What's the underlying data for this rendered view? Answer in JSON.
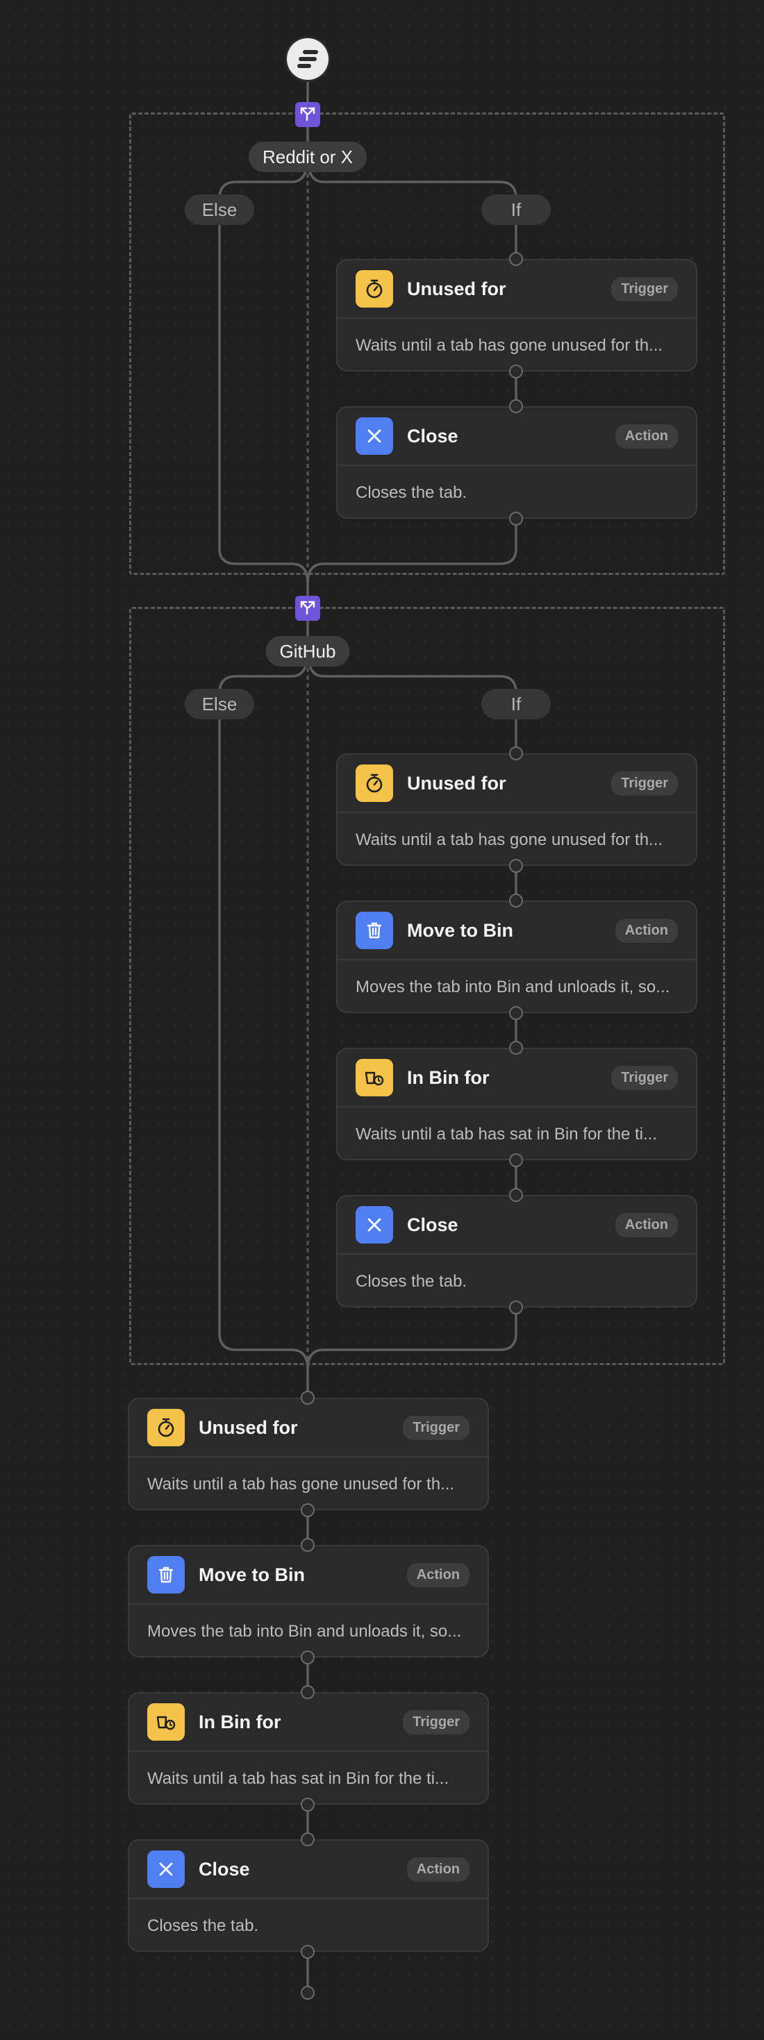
{
  "colors": {
    "background": "#1f1f1f",
    "card": "#2a2a2a",
    "wire": "#5f5f5f",
    "trigger_icon": "#f6c34a",
    "action_icon": "#4f7ff0",
    "branch_icon": "#6e54d8"
  },
  "start": {
    "icon": "start-icon"
  },
  "groups": [
    {
      "condition_label": "Reddit or X",
      "else_label": "Else",
      "if_label": "If",
      "steps": [
        {
          "icon": "stopwatch-icon",
          "kind": "trigger",
          "title": "Unused for",
          "badge": "Trigger",
          "description": "Waits until a tab has gone unused for th..."
        },
        {
          "icon": "close-x-icon",
          "kind": "action",
          "title": "Close",
          "badge": "Action",
          "description": "Closes the tab."
        }
      ]
    },
    {
      "condition_label": "GitHub",
      "else_label": "Else",
      "if_label": "If",
      "steps": [
        {
          "icon": "stopwatch-icon",
          "kind": "trigger",
          "title": "Unused for",
          "badge": "Trigger",
          "description": "Waits until a tab has gone unused for th..."
        },
        {
          "icon": "trash-icon",
          "kind": "action",
          "title": "Move to Bin",
          "badge": "Action",
          "description": "Moves the tab into Bin and unloads it, so..."
        },
        {
          "icon": "bin-timer-icon",
          "kind": "trigger",
          "title": "In Bin for",
          "badge": "Trigger",
          "description": "Waits until a tab has sat in Bin for the ti..."
        },
        {
          "icon": "close-x-icon",
          "kind": "action",
          "title": "Close",
          "badge": "Action",
          "description": "Closes the tab."
        }
      ]
    }
  ],
  "main_steps": [
    {
      "icon": "stopwatch-icon",
      "kind": "trigger",
      "title": "Unused for",
      "badge": "Trigger",
      "description": "Waits until a tab has gone unused for th..."
    },
    {
      "icon": "trash-icon",
      "kind": "action",
      "title": "Move to Bin",
      "badge": "Action",
      "description": "Moves the tab into Bin and unloads it, so..."
    },
    {
      "icon": "bin-timer-icon",
      "kind": "trigger",
      "title": "In Bin for",
      "badge": "Trigger",
      "description": "Waits until a tab has sat in Bin for the ti..."
    },
    {
      "icon": "close-x-icon",
      "kind": "action",
      "title": "Close",
      "badge": "Action",
      "description": "Closes the tab."
    }
  ]
}
